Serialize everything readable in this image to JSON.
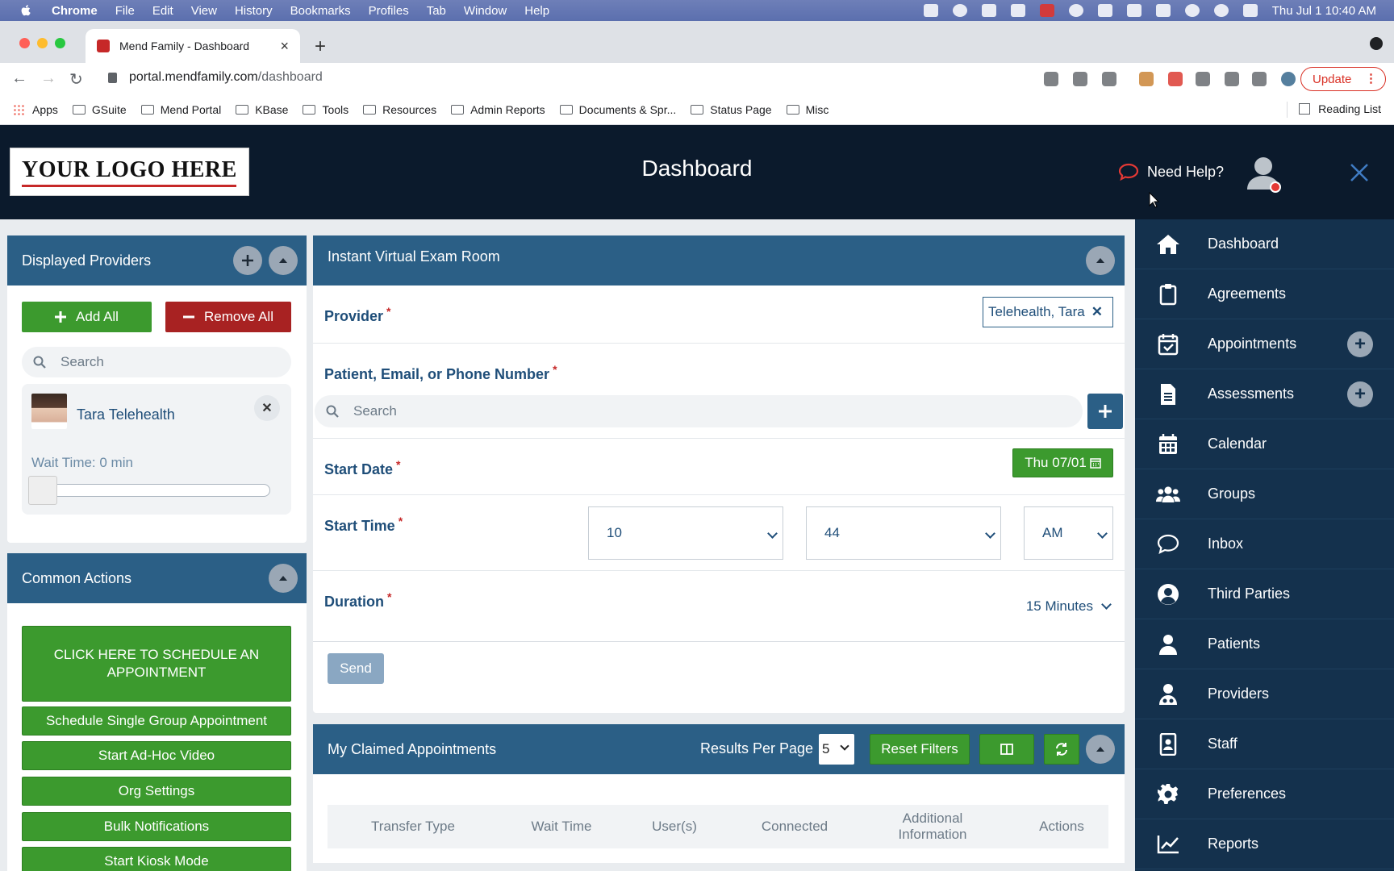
{
  "macos": {
    "menu": [
      "Chrome",
      "File",
      "Edit",
      "View",
      "History",
      "Bookmarks",
      "Profiles",
      "Tab",
      "Window",
      "Help"
    ],
    "clock": "Thu Jul 1  10:40 AM"
  },
  "browser": {
    "tab_title": "Mend Family - Dashboard",
    "url_domain": "portal.mendfamily.com",
    "url_path": "/dashboard",
    "update_label": "Update",
    "bookmarks": [
      "Apps",
      "GSuite",
      "Mend Portal",
      "KBase",
      "Tools",
      "Resources",
      "Admin Reports",
      "Documents & Spr...",
      "Status Page",
      "Misc"
    ],
    "reading_list": "Reading List"
  },
  "header": {
    "logo_text": "YOUR LOGO HERE",
    "title": "Dashboard",
    "need_help": "Need Help?"
  },
  "displayed_providers": {
    "title": "Displayed Providers",
    "add_all": "Add All",
    "remove_all": "Remove All",
    "search_placeholder": "Search",
    "provider_name": "Tara Telehealth",
    "wait_time": "Wait Time: 0 min",
    "slider_value": 0
  },
  "common_actions": {
    "title": "Common Actions",
    "buttons": [
      "CLICK HERE TO SCHEDULE AN APPOINTMENT",
      "Schedule Single Group Appointment",
      "Start Ad-Hoc Video",
      "Org Settings",
      "Bulk Notifications",
      "Start Kiosk Mode"
    ]
  },
  "exam_room": {
    "title": "Instant Virtual Exam Room",
    "provider_label": "Provider",
    "provider_value": "Telehealth, Tara",
    "patient_label": "Patient, Email, or Phone Number",
    "patient_placeholder": "Search",
    "start_date_label": "Start Date",
    "start_date_value": "Thu 07/01",
    "start_time_label": "Start Time",
    "hour": "10",
    "minute": "44",
    "ampm": "AM",
    "duration_label": "Duration",
    "duration_value": "15 Minutes",
    "send": "Send"
  },
  "claimed": {
    "title": "My Claimed Appointments",
    "results_per_page_label": "Results Per Page",
    "results_per_page": "5",
    "reset_filters": "Reset Filters",
    "columns": [
      "Transfer Type",
      "Wait Time",
      "User(s)",
      "Connected",
      "Additional Information",
      "Actions"
    ]
  },
  "nav": {
    "items": [
      {
        "label": "Dashboard",
        "icon": "home-icon"
      },
      {
        "label": "Agreements",
        "icon": "clipboard-icon"
      },
      {
        "label": "Appointments",
        "icon": "calendar-check-icon"
      },
      {
        "label": "Assessments",
        "icon": "document-icon"
      },
      {
        "label": "Calendar",
        "icon": "calendar-icon"
      },
      {
        "label": "Groups",
        "icon": "users-icon"
      },
      {
        "label": "Inbox",
        "icon": "chat-icon"
      },
      {
        "label": "Third Parties",
        "icon": "user-circle-icon"
      },
      {
        "label": "Patients",
        "icon": "user-icon"
      },
      {
        "label": "Providers",
        "icon": "doctor-icon"
      },
      {
        "label": "Staff",
        "icon": "id-badge-icon"
      },
      {
        "label": "Preferences",
        "icon": "gear-icon"
      },
      {
        "label": "Reports",
        "icon": "chart-line-icon"
      }
    ]
  },
  "colors": {
    "header_bg": "#0b1a2c",
    "panel_head": "#2b5f86",
    "nav_bg": "#14314d",
    "green": "#3c9a2e",
    "red": "#a82222"
  }
}
